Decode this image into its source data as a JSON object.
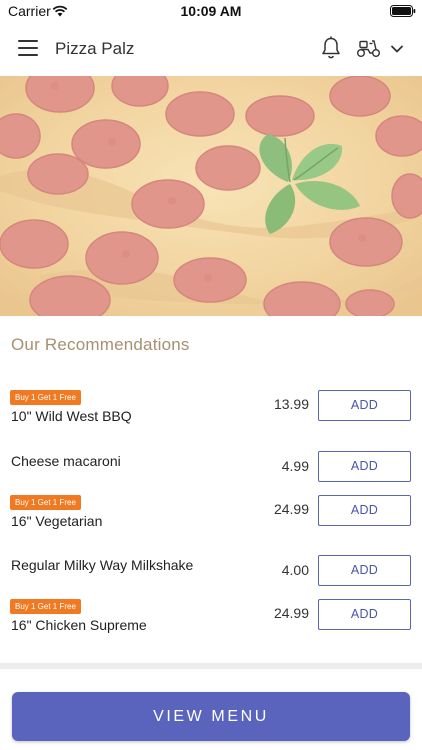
{
  "status_bar": {
    "carrier": "Carrier",
    "time": "10:09 AM"
  },
  "nav": {
    "title": "Pizza Palz",
    "icons": [
      "menu-icon",
      "bell-icon",
      "scooter-icon",
      "chevron-down-icon"
    ]
  },
  "hero": {
    "image": "pepperoni pizza with basil"
  },
  "recommendations": {
    "title": "Our Recommendations",
    "items": [
      {
        "badge": "Buy 1 Get 1 Free",
        "name": "10\" Wild West BBQ",
        "price": "13.99",
        "button": "ADD"
      },
      {
        "badge": "",
        "name": "Cheese macaroni",
        "price": "4.99",
        "button": "ADD"
      },
      {
        "badge": "Buy 1 Get 1 Free",
        "name": "16\" Vegetarian",
        "price": "24.99",
        "button": "ADD"
      },
      {
        "badge": "",
        "name": "Regular Milky Way Milkshake",
        "price": "4.00",
        "button": "ADD"
      },
      {
        "badge": "Buy 1 Get 1 Free",
        "name": "16\" Chicken Supreme",
        "price": "24.99",
        "button": "ADD"
      }
    ]
  },
  "footer": {
    "view_menu_label": "VIEW MENU"
  },
  "colors": {
    "accent": "#5a64bd",
    "badge": "#f07a22",
    "section_title": "#a8906e"
  }
}
